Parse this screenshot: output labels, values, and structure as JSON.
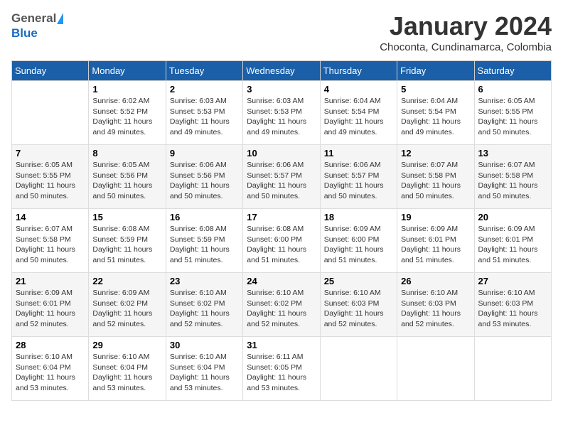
{
  "header": {
    "logo_general": "General",
    "logo_blue": "Blue",
    "month": "January 2024",
    "location": "Choconta, Cundinamarca, Colombia"
  },
  "days_of_week": [
    "Sunday",
    "Monday",
    "Tuesday",
    "Wednesday",
    "Thursday",
    "Friday",
    "Saturday"
  ],
  "weeks": [
    [
      {
        "day": "",
        "info": ""
      },
      {
        "day": "1",
        "info": "Sunrise: 6:02 AM\nSunset: 5:52 PM\nDaylight: 11 hours\nand 49 minutes."
      },
      {
        "day": "2",
        "info": "Sunrise: 6:03 AM\nSunset: 5:53 PM\nDaylight: 11 hours\nand 49 minutes."
      },
      {
        "day": "3",
        "info": "Sunrise: 6:03 AM\nSunset: 5:53 PM\nDaylight: 11 hours\nand 49 minutes."
      },
      {
        "day": "4",
        "info": "Sunrise: 6:04 AM\nSunset: 5:54 PM\nDaylight: 11 hours\nand 49 minutes."
      },
      {
        "day": "5",
        "info": "Sunrise: 6:04 AM\nSunset: 5:54 PM\nDaylight: 11 hours\nand 49 minutes."
      },
      {
        "day": "6",
        "info": "Sunrise: 6:05 AM\nSunset: 5:55 PM\nDaylight: 11 hours\nand 50 minutes."
      }
    ],
    [
      {
        "day": "7",
        "info": "Sunrise: 6:05 AM\nSunset: 5:55 PM\nDaylight: 11 hours\nand 50 minutes."
      },
      {
        "day": "8",
        "info": "Sunrise: 6:05 AM\nSunset: 5:56 PM\nDaylight: 11 hours\nand 50 minutes."
      },
      {
        "day": "9",
        "info": "Sunrise: 6:06 AM\nSunset: 5:56 PM\nDaylight: 11 hours\nand 50 minutes."
      },
      {
        "day": "10",
        "info": "Sunrise: 6:06 AM\nSunset: 5:57 PM\nDaylight: 11 hours\nand 50 minutes."
      },
      {
        "day": "11",
        "info": "Sunrise: 6:06 AM\nSunset: 5:57 PM\nDaylight: 11 hours\nand 50 minutes."
      },
      {
        "day": "12",
        "info": "Sunrise: 6:07 AM\nSunset: 5:58 PM\nDaylight: 11 hours\nand 50 minutes."
      },
      {
        "day": "13",
        "info": "Sunrise: 6:07 AM\nSunset: 5:58 PM\nDaylight: 11 hours\nand 50 minutes."
      }
    ],
    [
      {
        "day": "14",
        "info": "Sunrise: 6:07 AM\nSunset: 5:58 PM\nDaylight: 11 hours\nand 50 minutes."
      },
      {
        "day": "15",
        "info": "Sunrise: 6:08 AM\nSunset: 5:59 PM\nDaylight: 11 hours\nand 51 minutes."
      },
      {
        "day": "16",
        "info": "Sunrise: 6:08 AM\nSunset: 5:59 PM\nDaylight: 11 hours\nand 51 minutes."
      },
      {
        "day": "17",
        "info": "Sunrise: 6:08 AM\nSunset: 6:00 PM\nDaylight: 11 hours\nand 51 minutes."
      },
      {
        "day": "18",
        "info": "Sunrise: 6:09 AM\nSunset: 6:00 PM\nDaylight: 11 hours\nand 51 minutes."
      },
      {
        "day": "19",
        "info": "Sunrise: 6:09 AM\nSunset: 6:01 PM\nDaylight: 11 hours\nand 51 minutes."
      },
      {
        "day": "20",
        "info": "Sunrise: 6:09 AM\nSunset: 6:01 PM\nDaylight: 11 hours\nand 51 minutes."
      }
    ],
    [
      {
        "day": "21",
        "info": "Sunrise: 6:09 AM\nSunset: 6:01 PM\nDaylight: 11 hours\nand 52 minutes."
      },
      {
        "day": "22",
        "info": "Sunrise: 6:09 AM\nSunset: 6:02 PM\nDaylight: 11 hours\nand 52 minutes."
      },
      {
        "day": "23",
        "info": "Sunrise: 6:10 AM\nSunset: 6:02 PM\nDaylight: 11 hours\nand 52 minutes."
      },
      {
        "day": "24",
        "info": "Sunrise: 6:10 AM\nSunset: 6:02 PM\nDaylight: 11 hours\nand 52 minutes."
      },
      {
        "day": "25",
        "info": "Sunrise: 6:10 AM\nSunset: 6:03 PM\nDaylight: 11 hours\nand 52 minutes."
      },
      {
        "day": "26",
        "info": "Sunrise: 6:10 AM\nSunset: 6:03 PM\nDaylight: 11 hours\nand 52 minutes."
      },
      {
        "day": "27",
        "info": "Sunrise: 6:10 AM\nSunset: 6:03 PM\nDaylight: 11 hours\nand 53 minutes."
      }
    ],
    [
      {
        "day": "28",
        "info": "Sunrise: 6:10 AM\nSunset: 6:04 PM\nDaylight: 11 hours\nand 53 minutes."
      },
      {
        "day": "29",
        "info": "Sunrise: 6:10 AM\nSunset: 6:04 PM\nDaylight: 11 hours\nand 53 minutes."
      },
      {
        "day": "30",
        "info": "Sunrise: 6:10 AM\nSunset: 6:04 PM\nDaylight: 11 hours\nand 53 minutes."
      },
      {
        "day": "31",
        "info": "Sunrise: 6:11 AM\nSunset: 6:05 PM\nDaylight: 11 hours\nand 53 minutes."
      },
      {
        "day": "",
        "info": ""
      },
      {
        "day": "",
        "info": ""
      },
      {
        "day": "",
        "info": ""
      }
    ]
  ]
}
